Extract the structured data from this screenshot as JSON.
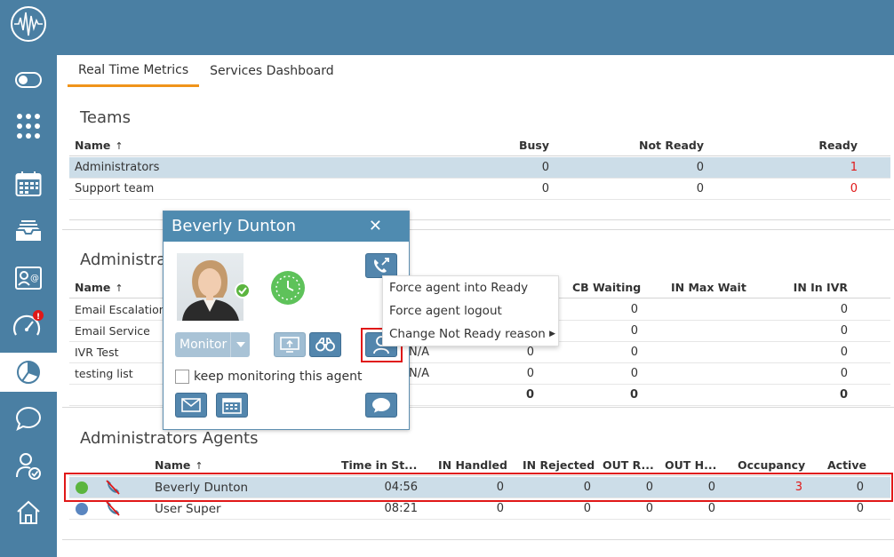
{
  "tabs": [
    {
      "label": "Real Time Metrics"
    },
    {
      "label": "Services Dashboard"
    }
  ],
  "teams": {
    "title": "Teams",
    "headers": {
      "name": "Name",
      "busy": "Busy",
      "not_ready": "Not Ready",
      "ready": "Ready"
    },
    "rows": [
      {
        "name": "Administrators",
        "busy": "0",
        "not_ready": "0",
        "ready": "1"
      },
      {
        "name": "Support team",
        "busy": "0",
        "not_ready": "0",
        "ready": "0"
      }
    ]
  },
  "services": {
    "title": "Administrators",
    "headers": {
      "name": "Name",
      "cb_waiting": "CB Waiting",
      "in_max_wait": "IN Max Wait",
      "in_in_ivr": "IN In IVR"
    },
    "rows": [
      {
        "name": "Email Escalation",
        "col_a": "",
        "col_b": "",
        "cb_waiting": "0",
        "in_in_ivr": "0"
      },
      {
        "name": "Email Service",
        "col_a": "",
        "col_b": "",
        "cb_waiting": "0",
        "in_in_ivr": "0"
      },
      {
        "name": "IVR Test",
        "col_a": "N/A",
        "col_b": "0",
        "cb_waiting": "0",
        "in_in_ivr": "0"
      },
      {
        "name": "testing list",
        "col_a": "N/A",
        "col_b": "0",
        "cb_waiting": "0",
        "in_in_ivr": "0"
      }
    ],
    "totals": {
      "col_b": "0",
      "cb_waiting": "0",
      "in_in_ivr": "0"
    }
  },
  "agents": {
    "title": "Administrators Agents",
    "headers": {
      "name": "Name",
      "time": "Time in St...",
      "in_handled": "IN Handled",
      "in_rejected": "IN Rejected",
      "out_r": "OUT R...",
      "out_h": "OUT H...",
      "occupancy": "Occupancy",
      "active": "Active"
    },
    "rows": [
      {
        "name": "Beverly Dunton",
        "time": "04:56",
        "in_handled": "0",
        "in_rejected": "0",
        "out_r": "0",
        "out_h": "0",
        "occupancy": "3",
        "active": "0",
        "status_color": "#5bb53f"
      },
      {
        "name": "User Super",
        "time": "08:21",
        "in_handled": "0",
        "in_rejected": "0",
        "out_r": "0",
        "out_h": "0",
        "occupancy": "",
        "active": "0",
        "status_color": "#5a86c0"
      }
    ]
  },
  "popup": {
    "agent_name": "Beverly Dunton",
    "monitor_label": "Monitor",
    "keep_monitoring_label": "keep monitoring this agent"
  },
  "context_menu": [
    {
      "label": "Force agent into Ready"
    },
    {
      "label": "Force agent logout"
    },
    {
      "label": "Change Not Ready reason"
    }
  ],
  "sidebar": {
    "badge": "!",
    "items": [
      "logo-icon",
      "toggle-icon",
      "grid-icon",
      "calendar-icon",
      "inbox-icon",
      "contact-card-icon",
      "speedometer-icon",
      "pie-chart-icon",
      "chat-icon",
      "user-check-icon",
      "home-icon"
    ]
  },
  "colors": {
    "accent": "#f0941a",
    "brand": "#4a7fa3",
    "alert": "#e01818",
    "selected_row": "#ccdde8"
  }
}
